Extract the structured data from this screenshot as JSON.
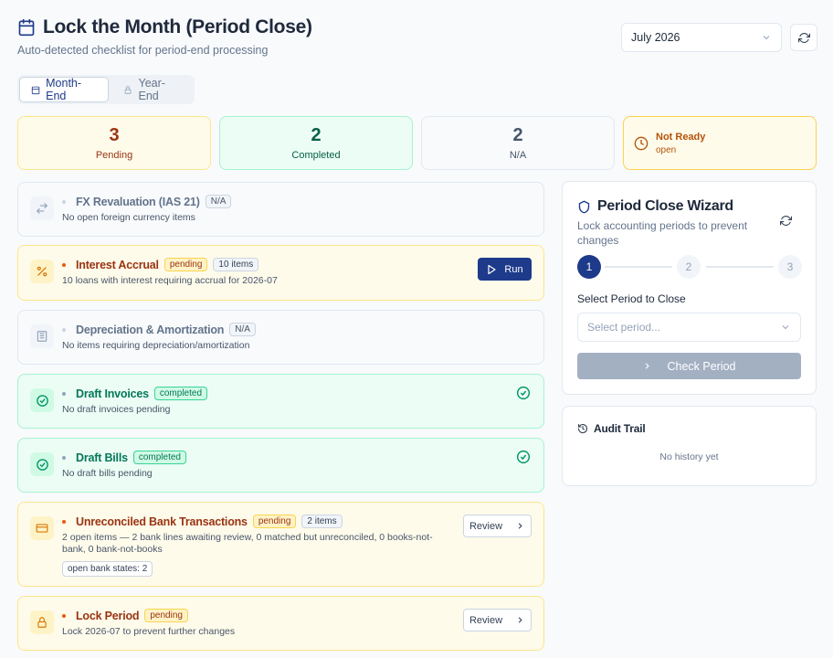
{
  "header": {
    "title": "Lock the Month (Period Close)",
    "subtitle": "Auto-detected checklist for period-end processing",
    "period_value": "July 2026"
  },
  "tabs": [
    {
      "label": "Month-End",
      "active": true,
      "icon": "calendar-icon"
    },
    {
      "label": "Year-End",
      "active": false,
      "icon": "lock-icon"
    }
  ],
  "stats": {
    "pending": {
      "count": "3",
      "label": "Pending"
    },
    "completed": {
      "count": "2",
      "label": "Completed"
    },
    "na": {
      "count": "2",
      "label": "N/A"
    },
    "status": {
      "label": "Not Ready",
      "sub": "open"
    }
  },
  "checklist": [
    {
      "name": "FX Revaluation (IAS 21)",
      "status": "N/A",
      "desc": "No open foreign currency items",
      "icon": "exchange-icon"
    },
    {
      "name": "Interest Accrual",
      "status": "pending",
      "count": "10 items",
      "desc": "10 loans with interest requiring accrual for 2026-07",
      "action": "Run",
      "icon": "percent-icon"
    },
    {
      "name": "Depreciation & Amortization",
      "status": "N/A",
      "desc": "No items requiring depreciation/amortization",
      "icon": "building-icon"
    },
    {
      "name": "Draft Invoices",
      "status": "completed",
      "desc": "No draft invoices pending",
      "icon": "check-circle-icon"
    },
    {
      "name": "Draft Bills",
      "status": "completed",
      "desc": "No draft bills pending",
      "icon": "check-circle-icon"
    },
    {
      "name": "Unreconciled Bank Transactions",
      "status": "pending",
      "count": "2 items",
      "desc": "2 open items — 2 bank lines awaiting review, 0 matched but unreconciled, 0 books-not-bank, 0 bank-not-books",
      "chip": "open bank states: 2",
      "action": "Review",
      "icon": "credit-card-icon"
    },
    {
      "name": "Lock Period",
      "status": "pending",
      "desc": "Lock 2026-07 to prevent further changes",
      "action": "Review",
      "icon": "lock-icon"
    }
  ],
  "wizard": {
    "title": "Period Close Wizard",
    "subtitle": "Lock accounting periods to prevent changes",
    "steps": [
      "1",
      "2",
      "3"
    ],
    "select_label": "Select Period to Close",
    "select_placeholder": "Select period...",
    "check_button": "Check Period"
  },
  "audit": {
    "title": "Audit Trail",
    "empty": "No history yet"
  },
  "colors": {
    "primary": "#1e3a8a",
    "pending": "#9a3412",
    "completed": "#047857"
  }
}
